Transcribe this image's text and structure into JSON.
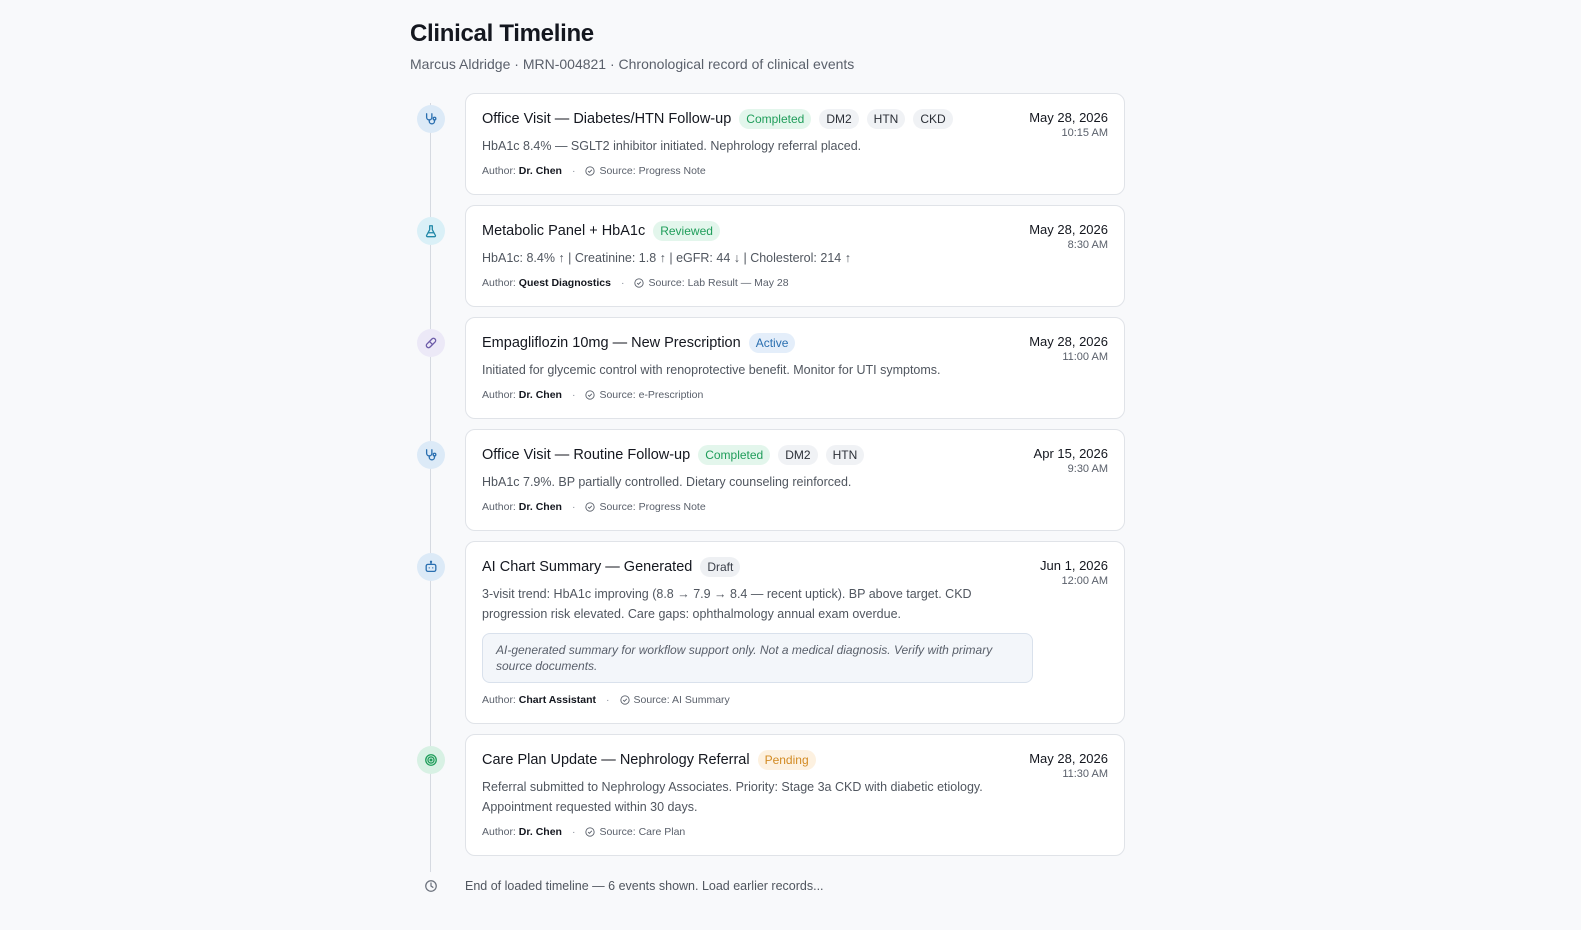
{
  "header": {
    "title": "Clinical Timeline",
    "subtitle": "Marcus Aldridge · MRN-004821 · Chronological record of clinical events"
  },
  "colors": {
    "completed": "#1f9d5a",
    "active": "#2a6fb0",
    "pending": "#d28a22",
    "accent_blue": "#2a6fb0"
  },
  "labels": {
    "author_prefix": "Author:",
    "source_prefix": "Source:",
    "separator": "·"
  },
  "events": [
    {
      "icon": "stethoscope-icon",
      "title": "Office Visit — Diabetes/HTN Follow-up",
      "status": "Completed",
      "tags": [
        "DM2",
        "HTN",
        "CKD"
      ],
      "date": "May 28, 2026",
      "time": "10:15 AM",
      "body": "HbA1c 8.4% — SGLT2 inhibitor initiated. Nephrology referral placed.",
      "author": "Dr. Chen",
      "source": "Progress Note"
    },
    {
      "icon": "flask-icon",
      "title": "Metabolic Panel + HbA1c",
      "status": "Reviewed",
      "tags": [],
      "date": "May 28, 2026",
      "time": "8:30 AM",
      "body": "HbA1c: 8.4% ↑ | Creatinine: 1.8 ↑ | eGFR: 44 ↓ | Cholesterol: 214 ↑",
      "author": "Quest Diagnostics",
      "source": "Lab Result — May 28"
    },
    {
      "icon": "pill-icon",
      "title": "Empagliflozin 10mg — New Prescription",
      "status": "Active",
      "tags": [],
      "date": "May 28, 2026",
      "time": "11:00 AM",
      "body": "Initiated for glycemic control with renoprotective benefit. Monitor for UTI symptoms.",
      "author": "Dr. Chen",
      "source": "e-Prescription"
    },
    {
      "icon": "stethoscope-icon",
      "title": "Office Visit — Routine Follow-up",
      "status": "Completed",
      "tags": [
        "DM2",
        "HTN"
      ],
      "date": "Apr 15, 2026",
      "time": "9:30 AM",
      "body": "HbA1c 7.9%. BP partially controlled. Dietary counseling reinforced.",
      "author": "Dr. Chen",
      "source": "Progress Note"
    },
    {
      "icon": "robot-icon",
      "title": "AI Chart Summary — Generated",
      "status": "Draft",
      "tags": [],
      "date": "Jun 1, 2026",
      "time": "12:00 AM",
      "body": "3-visit trend: HbA1c improving (8.8 → 7.9 → 8.4 — recent uptick). BP above target. CKD progression risk elevated. Care gaps: ophthalmology annual exam overdue.",
      "disclaimer": "AI-generated summary for workflow support only. Not a medical diagnosis. Verify with primary source documents.",
      "author": "Chart Assistant",
      "source": "AI Summary"
    },
    {
      "icon": "target-icon",
      "title": "Care Plan Update — Nephrology Referral",
      "status": "Pending",
      "tags": [],
      "date": "May 28, 2026",
      "time": "11:30 AM",
      "body": "Referral submitted to Nephrology Associates. Priority: Stage 3a CKD with diabetic etiology. Appointment requested within 30 days.",
      "author": "Dr. Chen",
      "source": "Care Plan"
    }
  ],
  "footer": {
    "icon": "clock-icon",
    "text": "End of loaded timeline — 6 events shown. Load earlier records..."
  }
}
